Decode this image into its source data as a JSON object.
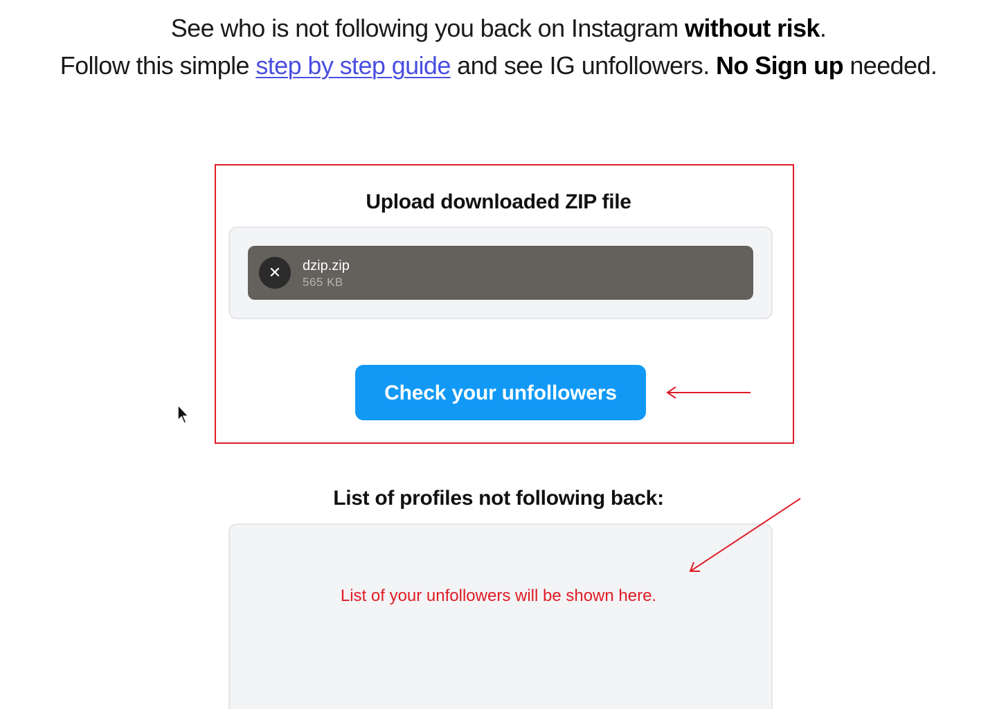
{
  "intro": {
    "line1_text": "See who is not following you back on Instagram ",
    "line1_bold": "without risk",
    "line1_end": ".",
    "line2_text": "Follow this simple ",
    "line2_link": "step by step guide",
    "line2_mid": " and see IG unfollowers. ",
    "line2_bold": "No Sign up",
    "line2_end": " needed."
  },
  "upload": {
    "title": "Upload downloaded ZIP file",
    "file": {
      "name": "dzip.zip",
      "size": "565 KB",
      "remove_icon": "close-icon"
    },
    "submit_label": "Check your unfollowers"
  },
  "results": {
    "title": "List of profiles not following back:",
    "placeholder": "List of your unfollowers will be shown here."
  },
  "colors": {
    "accent": "#1199f5",
    "annotation": "#e01b24",
    "link": "#4a4ee0",
    "file_item_bg": "#64605c"
  }
}
